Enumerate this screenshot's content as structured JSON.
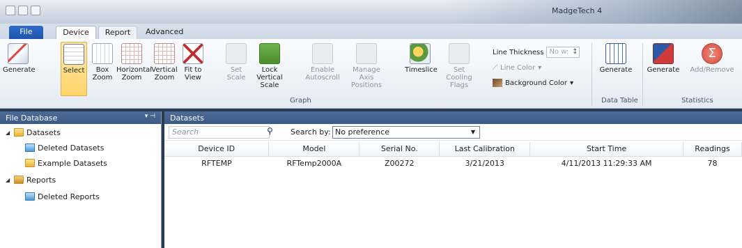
{
  "window": {
    "title": "MadgeTech 4"
  },
  "tabs": [
    {
      "label": "File"
    },
    {
      "label": "Device"
    },
    {
      "label": "Report"
    },
    {
      "label": "Advanced"
    }
  ],
  "ribbon": {
    "graph_group": {
      "label": "Graph",
      "buttons": [
        {
          "label": "Generate",
          "icon": "generate-graph-icon"
        },
        {
          "label": "Select",
          "icon": "select-icon",
          "selected": true
        },
        {
          "label": "Box Zoom",
          "icon": "box-zoom-icon"
        },
        {
          "label": "Horizontal Zoom",
          "icon": "horizontal-zoom-icon"
        },
        {
          "label": "Vertical Zoom",
          "icon": "vertical-zoom-icon"
        },
        {
          "label": "Fit to View",
          "icon": "fit-to-view-icon"
        },
        {
          "label": "Set Scale",
          "icon": "set-scale-icon",
          "disabled": true
        },
        {
          "label": "Lock Vertical Scale",
          "icon": "lock-vertical-scale-icon"
        },
        {
          "label": "Enable Autoscroll",
          "icon": "autoscroll-icon",
          "disabled": true
        },
        {
          "label": "Manage Axis Positions",
          "icon": "axis-icon",
          "disabled": true
        },
        {
          "label": "Timeslice",
          "icon": "timeslice-icon"
        },
        {
          "label": "Set Cooling Flags",
          "icon": "cooling-flags-icon",
          "disabled": true
        }
      ],
      "line_thickness_label": "Line Thickness",
      "line_thickness_value": "No w:",
      "line_color_label": "Line Color",
      "background_color_label": "Background Color"
    },
    "data_table_group": {
      "label": "Data Table",
      "button_label": "Generate"
    },
    "statistics_group": {
      "label": "Statistics",
      "generate_label": "Generate",
      "add_remove_label": "Add/Remove"
    }
  },
  "left_pane": {
    "title": "File Database",
    "tree": [
      {
        "label": "Datasets",
        "level": 0,
        "expanded": true
      },
      {
        "label": "Deleted Datasets",
        "level": 1
      },
      {
        "label": "Example Datasets",
        "level": 1
      },
      {
        "label": "Reports",
        "level": 0,
        "expanded": true
      },
      {
        "label": "Deleted Reports",
        "level": 1
      }
    ]
  },
  "right_pane": {
    "title": "Datasets",
    "search_placeholder": "Search",
    "search_by_label": "Search by:",
    "search_by_value": "No preference",
    "columns": [
      "Device ID",
      "Model",
      "Serial No.",
      "Last Calibration",
      "Start Time",
      "Readings"
    ],
    "rows": [
      [
        "RFTEMP",
        "RFTemp2000A",
        "Z00272",
        "3/21/2013",
        "4/11/2013 11:29:33 AM",
        "78"
      ]
    ]
  }
}
